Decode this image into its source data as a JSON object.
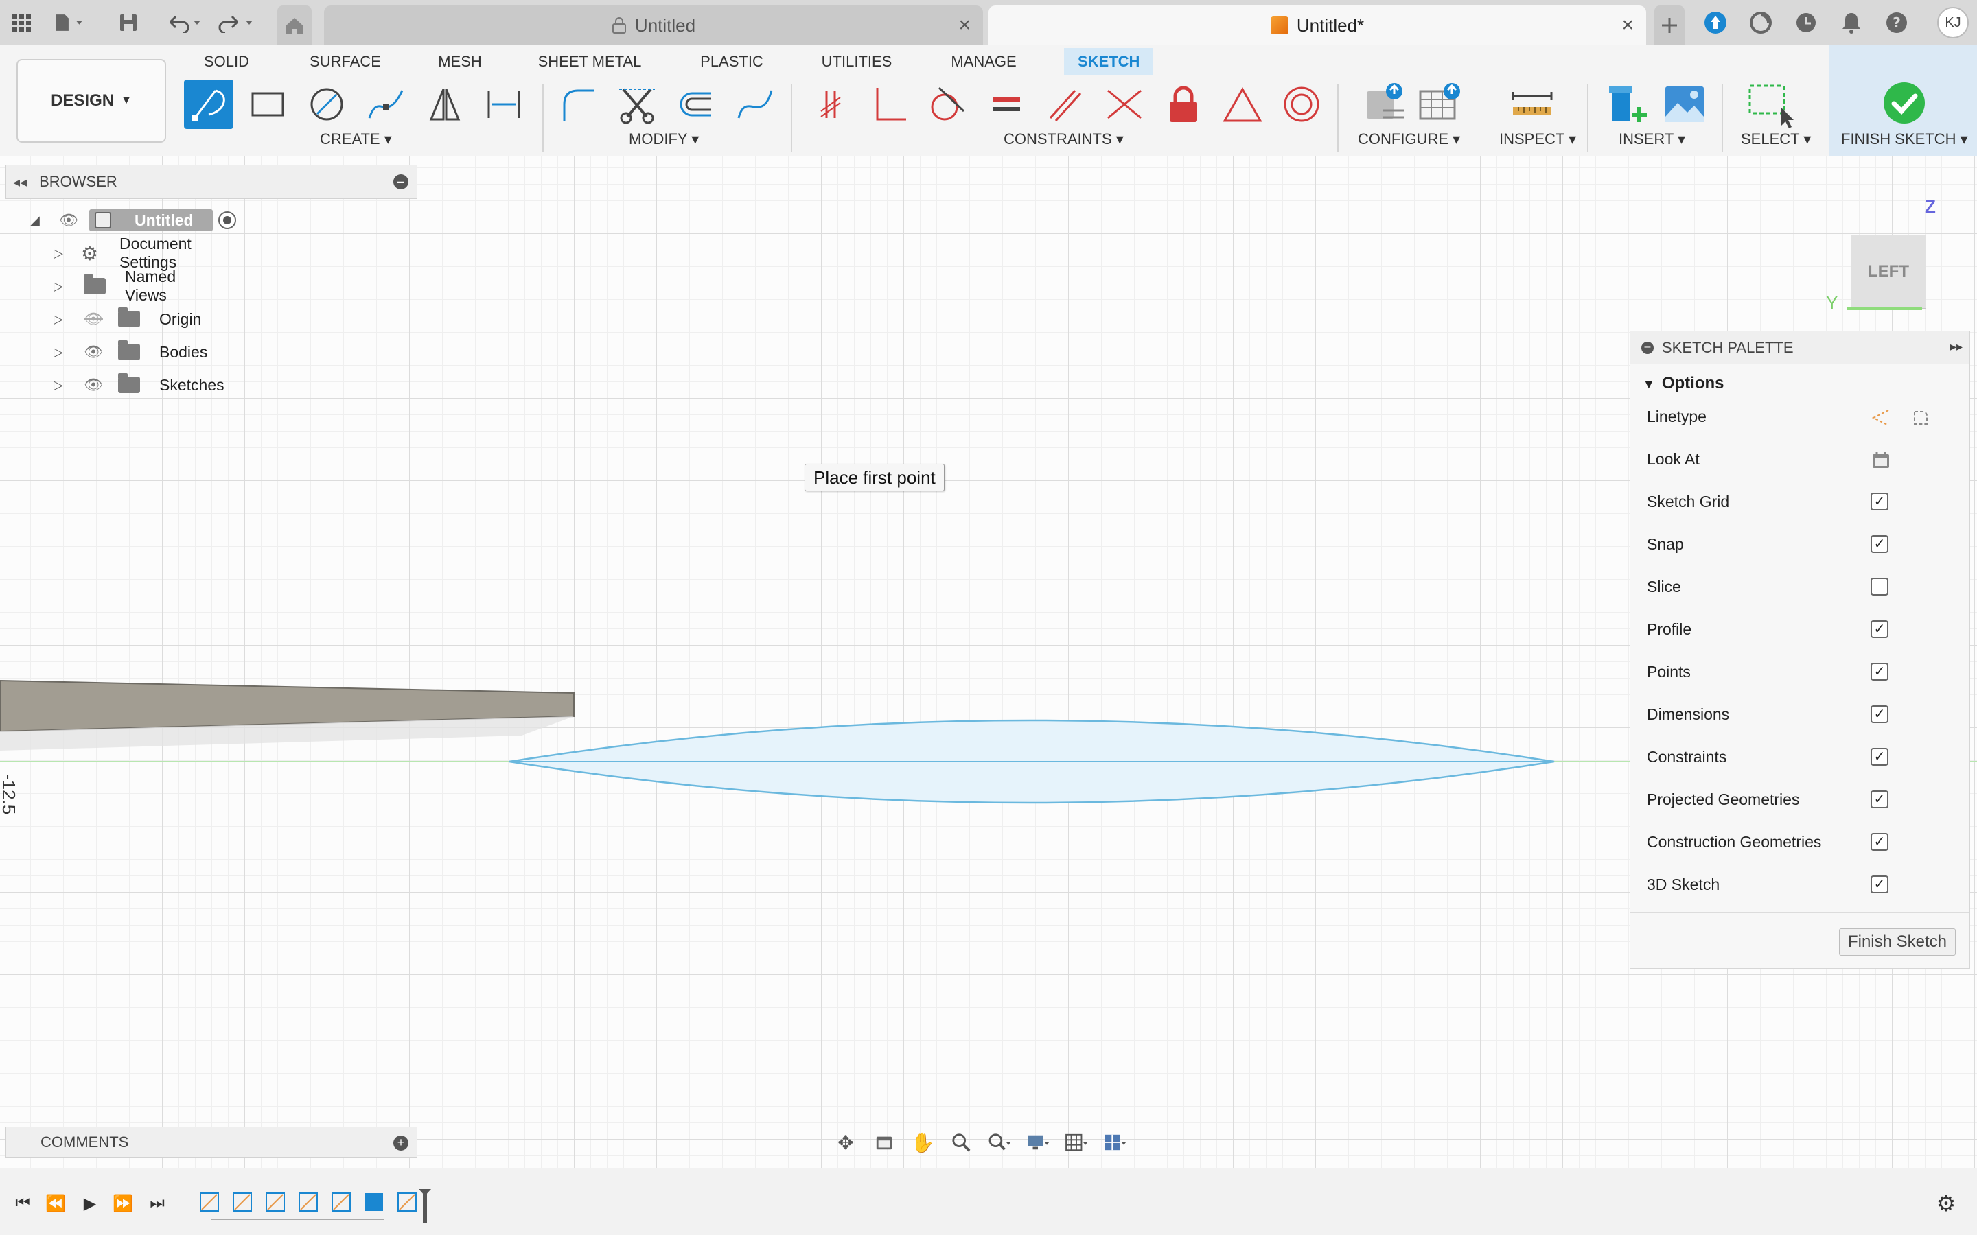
{
  "tabs": [
    {
      "label": "Untitled",
      "locked": true,
      "active": false
    },
    {
      "label": "Untitled*",
      "locked": false,
      "active": true
    }
  ],
  "user": {
    "initials": "KJ"
  },
  "workspace": {
    "design_label": "DESIGN",
    "tabs": [
      "SOLID",
      "SURFACE",
      "MESH",
      "SHEET METAL",
      "PLASTIC",
      "UTILITIES",
      "MANAGE",
      "SKETCH"
    ],
    "active_tab": "SKETCH"
  },
  "toolbar_groups": {
    "create": "CREATE",
    "modify": "MODIFY",
    "constraints": "CONSTRAINTS",
    "configure": "CONFIGURE",
    "inspect": "INSPECT",
    "insert": "INSERT",
    "select": "SELECT",
    "finish_sketch": "FINISH SKETCH"
  },
  "browser": {
    "title": "BROWSER",
    "root": "Untitled",
    "items": [
      "Document Settings",
      "Named Views",
      "Origin",
      "Bodies",
      "Sketches"
    ]
  },
  "tooltip": "Place first point",
  "axis_readout": "-12.5",
  "viewcube": {
    "face": "LEFT",
    "z_label": "Z",
    "y_label": "Y"
  },
  "sketch_palette": {
    "title": "SKETCH PALETTE",
    "section": "Options",
    "rows": [
      {
        "label": "Linetype",
        "type": "icons"
      },
      {
        "label": "Look At",
        "type": "icon"
      },
      {
        "label": "Sketch Grid",
        "type": "checkbox",
        "checked": true
      },
      {
        "label": "Snap",
        "type": "checkbox",
        "checked": true
      },
      {
        "label": "Slice",
        "type": "checkbox",
        "checked": false
      },
      {
        "label": "Profile",
        "type": "checkbox",
        "checked": true
      },
      {
        "label": "Points",
        "type": "checkbox",
        "checked": true
      },
      {
        "label": "Dimensions",
        "type": "checkbox",
        "checked": true
      },
      {
        "label": "Constraints",
        "type": "checkbox",
        "checked": true
      },
      {
        "label": "Projected Geometries",
        "type": "checkbox",
        "checked": true
      },
      {
        "label": "Construction Geometries",
        "type": "checkbox",
        "checked": true
      },
      {
        "label": "3D Sketch",
        "type": "checkbox",
        "checked": true
      }
    ],
    "finish_button": "Finish Sketch"
  },
  "comments": {
    "title": "COMMENTS"
  },
  "colors": {
    "accent": "#1a87d1",
    "finish_green": "#2fb84a",
    "constraint_red": "#d33b3b",
    "sketch_profile": "#6ab8de"
  }
}
